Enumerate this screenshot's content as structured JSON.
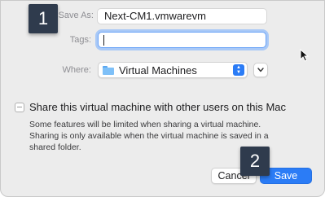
{
  "save_as": {
    "label": "Save As:",
    "value": "Next-CM1.vmwarevm"
  },
  "tags": {
    "label": "Tags:",
    "value": ""
  },
  "where": {
    "label": "Where:",
    "selected": "Virtual Machines",
    "icon": "folder-icon"
  },
  "share": {
    "checkbox_label": "Share this virtual machine with other users on this Mac",
    "note": "Some features will be limited when sharing a virtual machine. Sharing is only available when the virtual machine is saved in a shared folder."
  },
  "buttons": {
    "cancel": "Cancel",
    "save": "Save"
  },
  "callouts": {
    "one": "1",
    "two": "2"
  },
  "colors": {
    "accent": "#2b7cf6",
    "badge": "#2f3b4d",
    "background": "#ececec"
  }
}
